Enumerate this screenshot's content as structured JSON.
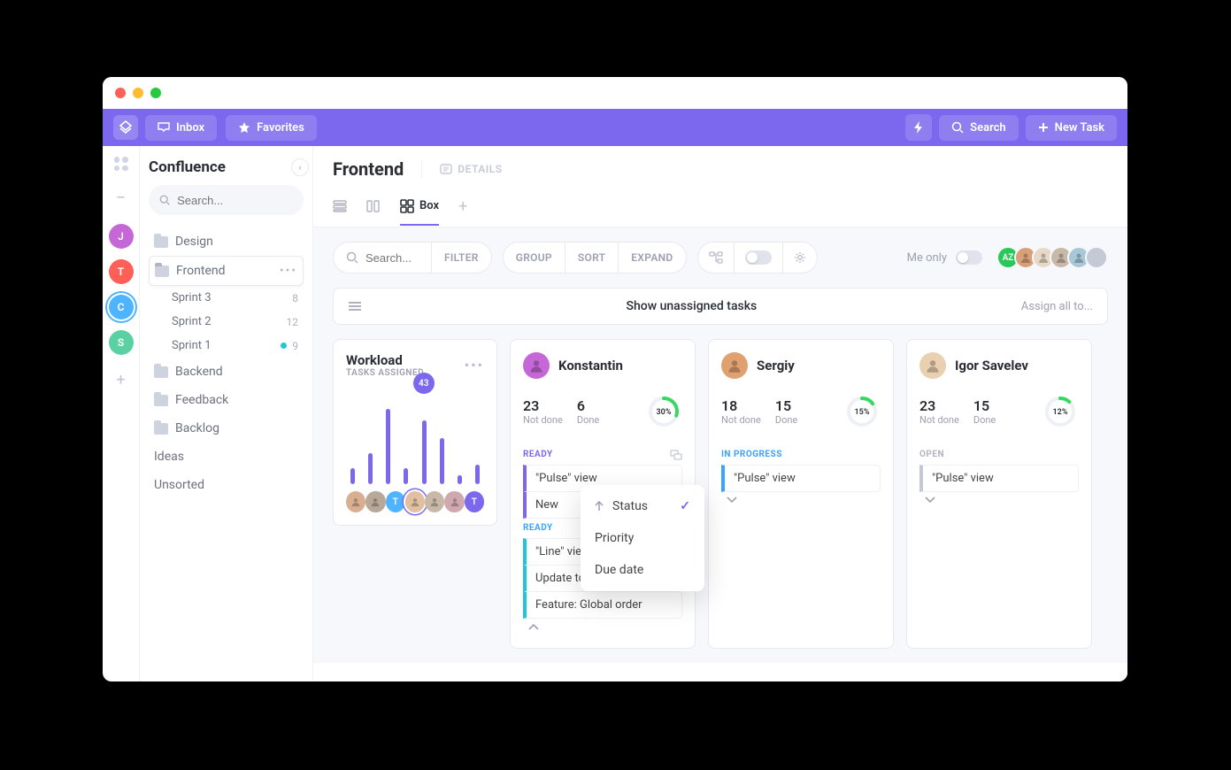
{
  "topbar": {
    "inbox": "Inbox",
    "favorites": "Favorites",
    "search": "Search",
    "newTask": "New Task"
  },
  "rail": {
    "spaces": [
      {
        "letter": "J",
        "color": "#c567d6"
      },
      {
        "letter": "T",
        "color": "#ff5f57"
      },
      {
        "letter": "C",
        "color": "#4fb4ff",
        "active": true
      },
      {
        "letter": "S",
        "color": "#5bd0a3"
      }
    ]
  },
  "sidebar": {
    "title": "Confluence",
    "searchPlaceholder": "Search...",
    "items": {
      "design": "Design",
      "frontend": "Frontend",
      "backend": "Backend",
      "feedback": "Feedback",
      "backlog": "Backlog",
      "ideas": "Ideas",
      "unsorted": "Unsorted"
    },
    "sprints": [
      {
        "name": "Sprint 3",
        "count": "8"
      },
      {
        "name": "Sprint 2",
        "count": "12"
      },
      {
        "name": "Sprint 1",
        "count": "9",
        "dot": true
      }
    ]
  },
  "content": {
    "title": "Frontend",
    "details": "DETAILS",
    "tabs": {
      "box": "Box"
    }
  },
  "toolbar": {
    "searchPlaceholder": "Search...",
    "filter": "FILTER",
    "group": "GROUP",
    "sort": "SORT",
    "expand": "EXPAND",
    "meOnly": "Me only",
    "avatars": [
      {
        "label": "AZ",
        "color": "#28c958"
      },
      {
        "photo": true,
        "color": "#d8a078"
      },
      {
        "photo": true,
        "color": "#e8d8c8"
      },
      {
        "photo": true,
        "color": "#c8b8a8"
      },
      {
        "photo": true,
        "color": "#a8c8d8"
      },
      {
        "label": "",
        "color": "#c5c9d6"
      }
    ]
  },
  "banner": {
    "title": "Show unassigned tasks",
    "assign": "Assign all to..."
  },
  "workload": {
    "title": "Workload",
    "sub": "TASKS ASSIGNED",
    "bubble": "43",
    "bars": [
      18,
      35,
      85,
      18,
      72,
      52,
      10,
      22
    ],
    "bubbleIndex": 4,
    "avatars": [
      {
        "photo": true,
        "color": "#d8b090"
      },
      {
        "photo": true,
        "color": "#b8a898"
      },
      {
        "letter": "T",
        "color": "#4fb4ff"
      },
      {
        "photo": true,
        "color": "#e0c0a0",
        "ring": true
      },
      {
        "photo": true,
        "color": "#c8b8a8"
      },
      {
        "photo": true,
        "color": "#d0a8b0"
      },
      {
        "letter": "T",
        "color": "#7b68ee"
      }
    ]
  },
  "people": [
    {
      "name": "Konstantin",
      "notDone": "23",
      "done": "6",
      "pct": "30%",
      "pctVal": 30,
      "color": "#c567d6",
      "sections": [
        {
          "label": "READY",
          "cls": "sl-ready",
          "showIcon": true,
          "tasks": [
            {
              "t": "\"Pulse\" view",
              "c": "purple"
            },
            {
              "t": "New",
              "c": "purple"
            }
          ]
        },
        {
          "label": "READY",
          "cls": "sl-progress",
          "tasks": [
            {
              "t": "\"Line\" view",
              "c": "cyan"
            },
            {
              "t": "Update to favorites UX",
              "c": "cyan"
            },
            {
              "t": "Feature: Global order",
              "c": "cyan"
            }
          ]
        }
      ],
      "showCollapse": true
    },
    {
      "name": "Sergiy",
      "notDone": "18",
      "done": "15",
      "pct": "15%",
      "pctVal": 15,
      "color": "#e0a070",
      "sections": [
        {
          "label": "IN PROGRESS",
          "cls": "sl-progress",
          "tasks": [
            {
              "t": "\"Pulse\" view",
              "c": "blue"
            }
          ]
        }
      ],
      "showMore": true
    },
    {
      "name": "Igor Savelev",
      "notDone": "23",
      "done": "15",
      "pct": "12%",
      "pctVal": 12,
      "color": "#e8d0b0",
      "sections": [
        {
          "label": "OPEN",
          "cls": "sl-open",
          "tasks": [
            {
              "t": "\"Pulse\" view",
              "c": "gray"
            }
          ]
        }
      ],
      "showMore": true
    }
  ],
  "labels": {
    "notDone": "Not done",
    "done": "Done"
  },
  "dropdown": {
    "visible": true,
    "items": [
      {
        "t": "Status",
        "sel": true,
        "arrow": true
      },
      {
        "t": "Priority"
      },
      {
        "t": "Due date"
      }
    ]
  }
}
